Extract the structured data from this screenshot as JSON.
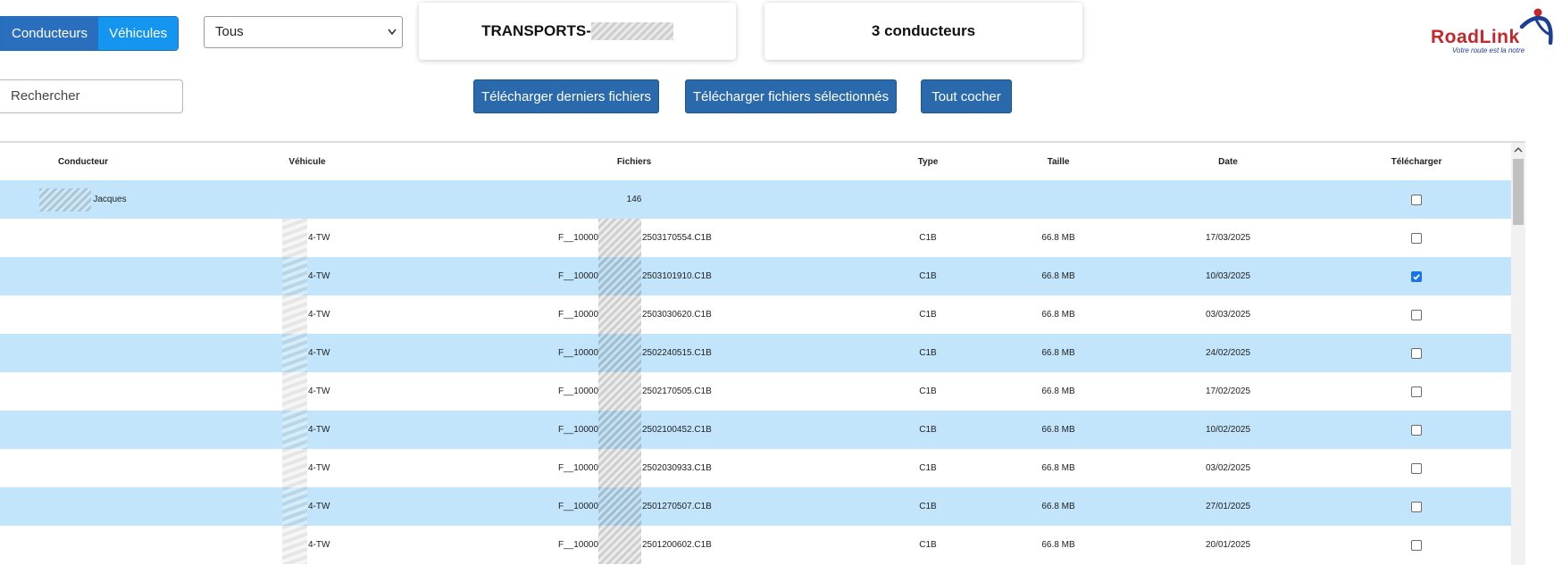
{
  "toggle": {
    "drivers_label": "Conducteurs",
    "vehicles_label": "Véhicules"
  },
  "filter": {
    "selected": "Tous"
  },
  "company_card": {
    "prefix": "TRANSPORTS-"
  },
  "count_card": {
    "text": "3 conducteurs"
  },
  "logo": {
    "brand_road": "Road",
    "brand_link": "Link",
    "tagline": "Votre route est la notre"
  },
  "search": {
    "placeholder": "Rechercher"
  },
  "actions": {
    "download_last": "Télécharger derniers fichiers",
    "download_selected": "Télécharger fichiers sélectionnés",
    "check_all": "Tout cocher"
  },
  "table": {
    "headers": {
      "driver": "Conducteur",
      "vehicle": "Véhicule",
      "files": "Fichiers",
      "type": "Type",
      "size": "Taille",
      "date": "Date",
      "download": "Télécharger"
    },
    "group": {
      "driver": "Jacques",
      "files_count": "146",
      "checked": false
    },
    "rows": [
      {
        "vehicle": "4-TW",
        "file_prefix": "F__10000",
        "file_suffix": "2503170554.C1B",
        "type": "C1B",
        "size": "66.8 MB",
        "date": "17/03/2025",
        "checked": false
      },
      {
        "vehicle": "4-TW",
        "file_prefix": "F__10000",
        "file_suffix": "2503101910.C1B",
        "type": "C1B",
        "size": "66.8 MB",
        "date": "10/03/2025",
        "checked": true
      },
      {
        "vehicle": "4-TW",
        "file_prefix": "F__10000",
        "file_suffix": "2503030620.C1B",
        "type": "C1B",
        "size": "66.8 MB",
        "date": "03/03/2025",
        "checked": false
      },
      {
        "vehicle": "4-TW",
        "file_prefix": "F__10000",
        "file_suffix": "2502240515.C1B",
        "type": "C1B",
        "size": "66.8 MB",
        "date": "24/02/2025",
        "checked": false
      },
      {
        "vehicle": "4-TW",
        "file_prefix": "F__10000",
        "file_suffix": "2502170505.C1B",
        "type": "C1B",
        "size": "66.8 MB",
        "date": "17/02/2025",
        "checked": false
      },
      {
        "vehicle": "4-TW",
        "file_prefix": "F__10000",
        "file_suffix": "2502100452.C1B",
        "type": "C1B",
        "size": "66.8 MB",
        "date": "10/02/2025",
        "checked": false
      },
      {
        "vehicle": "4-TW",
        "file_prefix": "F__10000",
        "file_suffix": "2502030933.C1B",
        "type": "C1B",
        "size": "66.8 MB",
        "date": "03/02/2025",
        "checked": false
      },
      {
        "vehicle": "4-TW",
        "file_prefix": "F__10000",
        "file_suffix": "2501270507.C1B",
        "type": "C1B",
        "size": "66.8 MB",
        "date": "27/01/2025",
        "checked": false
      },
      {
        "vehicle": "4-TW",
        "file_prefix": "F__10000",
        "file_suffix": "2501200602.C1B",
        "type": "C1B",
        "size": "66.8 MB",
        "date": "20/01/2025",
        "checked": false
      }
    ]
  },
  "colors": {
    "row_alt": "#c2e5fb",
    "button": "#2a6aac",
    "toggle_active": "#1496f0",
    "brand_red": "#c1272d",
    "brand_blue": "#1c3f94"
  }
}
